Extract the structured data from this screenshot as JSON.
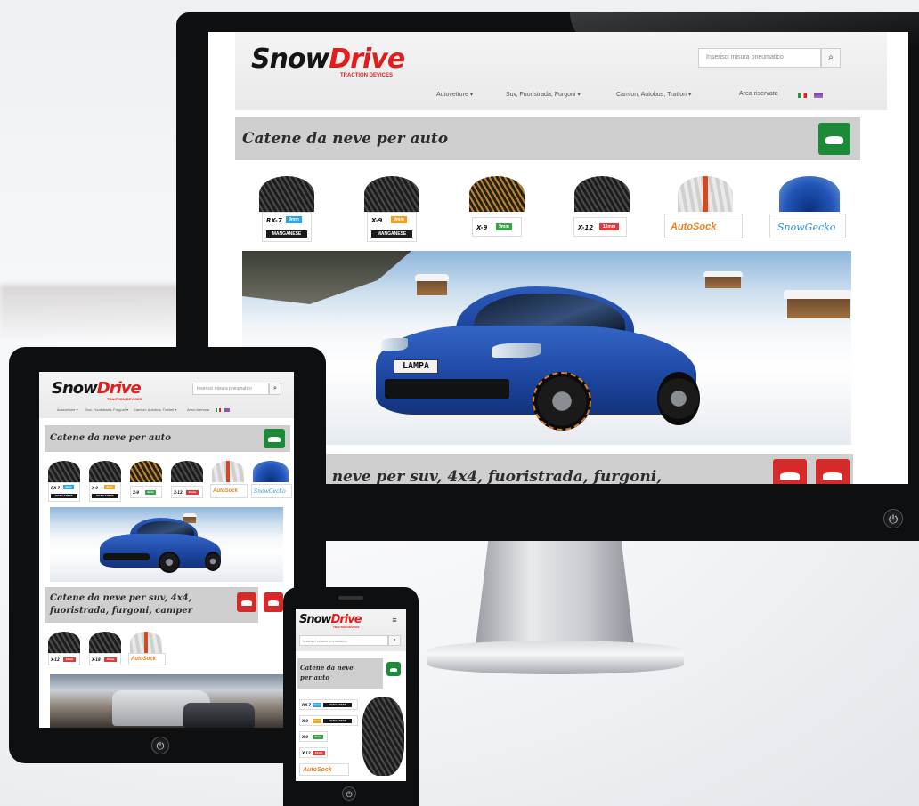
{
  "site": {
    "logo_snow": "Snow",
    "logo_drive": "Drive",
    "logo_sub": "TRACTION DEVICES",
    "search_placeholder": "Inserisci misura pneumatico",
    "menu_icon": "hamburger-icon",
    "search_icon": "search-icon",
    "nav": [
      {
        "label": "Autovetture ▾"
      },
      {
        "label": "Suv, Fuoristrada, Furgoni ▾"
      },
      {
        "label": "Camion, Autobus, Trattori ▾"
      },
      {
        "label": "Area riservata"
      }
    ],
    "section_car_title": "Catene da neve per auto",
    "section_suv_title": "Catene da neve per suv, 4x4, fuoristrada, furgoni, camper",
    "section_suv_title_partial": "e neve per suv, 4x4, fuoristrada, furgoni,",
    "phone_section_line1": "Catene da neve",
    "phone_section_line2": "per auto",
    "products": [
      {
        "name": "RX-7",
        "badge": "9mm",
        "badge2": "MANGANESE",
        "badge_color": "#2aa6e0"
      },
      {
        "name": "X-9",
        "badge": "9mm",
        "badge2": "MANGANESE",
        "badge_color": "#f0a21a"
      },
      {
        "name": "X-9",
        "badge": "9mm",
        "badge2": "",
        "badge_color": "#37a64a"
      },
      {
        "name": "X-12",
        "badge": "12mm",
        "badge2": "",
        "badge_color": "#e03a3a"
      },
      {
        "name": "AutoSock",
        "badge": "",
        "badge2": "",
        "badge_color": ""
      },
      {
        "name": "SnowGecko",
        "badge": "",
        "badge2": "",
        "badge_color": ""
      }
    ],
    "suv_products": [
      {
        "name": "X-12",
        "badge": "12mm",
        "badge_color": "#e03a3a"
      },
      {
        "name": "X-18",
        "badge": "18mm",
        "badge_color": "#e03a3a"
      },
      {
        "name": "AutoSock",
        "badge": ""
      }
    ],
    "plate_text": "LAMPA",
    "flag_it": "Italiano",
    "flag_other": "Altra lingua"
  },
  "colors": {
    "brand_red": "#e01e1e",
    "button_green": "#1d8a3a",
    "button_red": "#d42a2a",
    "title_bar": "#cfcfcf"
  }
}
